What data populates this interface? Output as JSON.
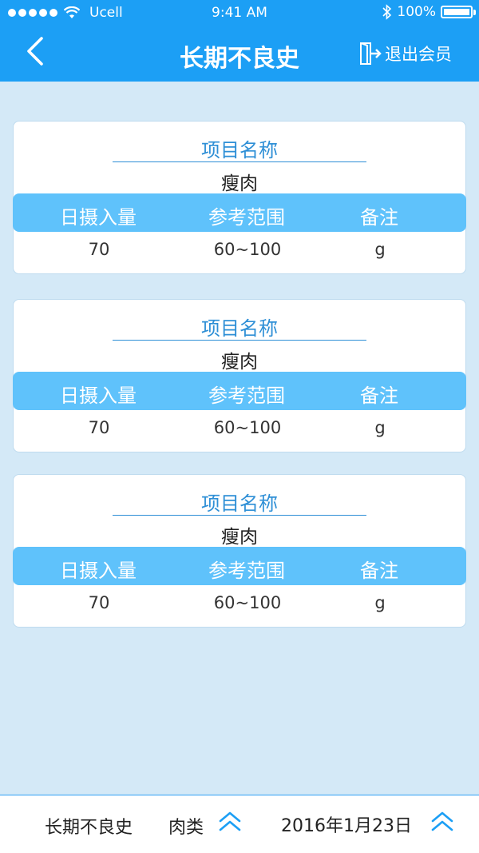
{
  "status": {
    "carrier": "Ucell",
    "time": "9:41 AM",
    "battery": "100%"
  },
  "header": {
    "title": "长期不良史",
    "logout": "退出会员"
  },
  "records": [
    {
      "name_label": "项目名称",
      "name": "瘦肉",
      "columns": [
        "日摄入量",
        "参考范围",
        "备注"
      ],
      "cells": [
        "70",
        "60~100",
        "g"
      ]
    },
    {
      "name_label": "项目名称",
      "name": "瘦肉",
      "columns": [
        "日摄入量",
        "参考范围",
        "备注"
      ],
      "cells": [
        "70",
        "60~100",
        "g"
      ]
    },
    {
      "name_label": "项目名称",
      "name": "瘦肉",
      "columns": [
        "日摄入量",
        "参考范围",
        "备注"
      ],
      "cells": [
        "70",
        "60~100",
        "g"
      ]
    }
  ],
  "footer": {
    "history": "长期不良史",
    "category": "肉类",
    "date": "2016年1月23日"
  },
  "colors": {
    "primary": "#1c9ff5",
    "header_row": "#5fc2fb",
    "background": "#d4e9f7",
    "accent_text": "#2e8fd6"
  },
  "icons": {
    "back": "chevron-left-icon",
    "logout": "exit-door-icon",
    "wifi": "wifi-icon",
    "bluetooth": "bluetooth-icon",
    "battery": "battery-icon",
    "expand": "double-chevron-up-icon"
  }
}
